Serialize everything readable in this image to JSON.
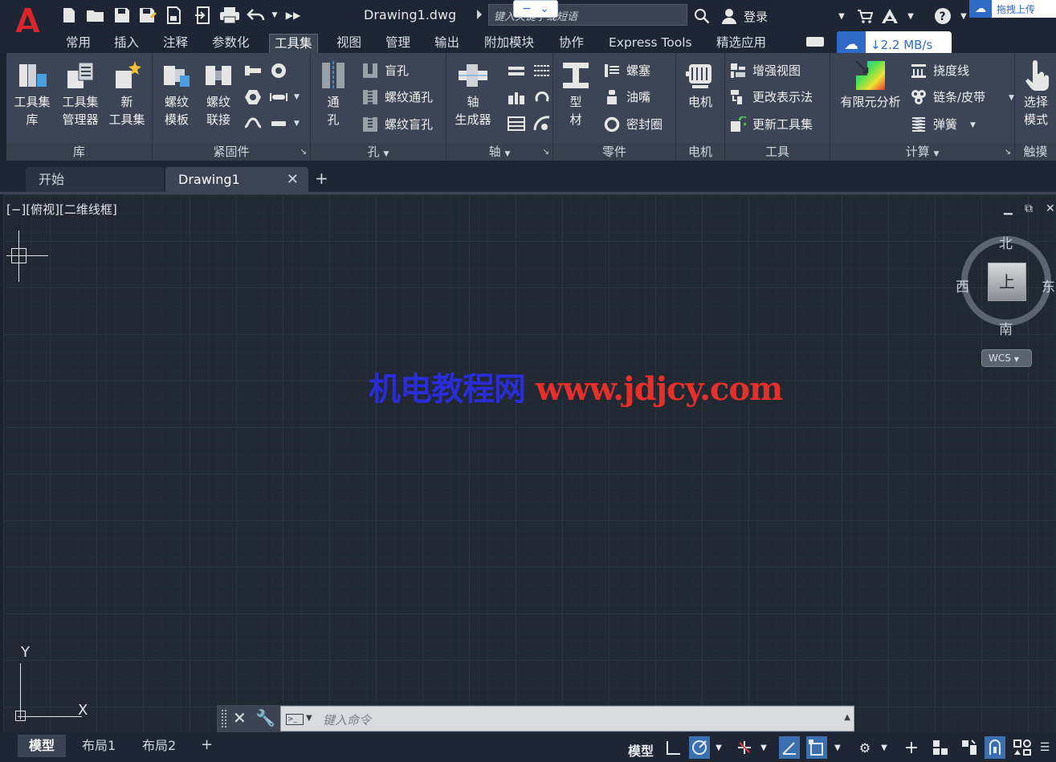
{
  "app": {
    "title": "Drawing1.dwg"
  },
  "titlebar": {
    "search_placeholder": "键入关键字或短语",
    "login_label": "登录",
    "cloud_upload_label": "拖拽上传"
  },
  "speed_widget": {
    "label": "↓2.2 MB/s"
  },
  "ribbon_tabs": [
    {
      "label": "常用"
    },
    {
      "label": "插入"
    },
    {
      "label": "注释"
    },
    {
      "label": "参数化"
    },
    {
      "label": "工具集"
    },
    {
      "label": "视图"
    },
    {
      "label": "管理"
    },
    {
      "label": "输出"
    },
    {
      "label": "附加模块"
    },
    {
      "label": "协作"
    },
    {
      "label": "Express Tools"
    },
    {
      "label": "精选应用"
    }
  ],
  "ribbon": {
    "lib": {
      "title": "库",
      "btn1": "工具集库",
      "btn1b": "库",
      "btn2": "工具集",
      "btn2b": "管理器",
      "btn3": "新",
      "btn3b": "工具集"
    },
    "fasteners": {
      "title": "紧固件",
      "btn1": "螺纹",
      "btn1b": "模板",
      "btn2": "螺纹",
      "btn2b": "联接"
    },
    "holes": {
      "title": "孔",
      "btn1": "通",
      "btn1b": "孔",
      "s1": "盲孔",
      "s2": "螺纹通孔",
      "s3": "螺纹盲孔"
    },
    "shaft": {
      "title": "轴",
      "btn1": "轴",
      "btn1b": "生成器"
    },
    "parts": {
      "title": "零件",
      "btn1": "型",
      "btn1b": "材",
      "s1": "螺塞",
      "s2": "油嘴",
      "s3": "密封圈"
    },
    "motor": {
      "title": "电机",
      "btn1": "电机"
    },
    "tools": {
      "title": "工具",
      "s1": "增强视图",
      "s2": "更改表示法",
      "s3": "更新工具集"
    },
    "calc": {
      "title": "计算",
      "btn1": "有限元分析",
      "s1": "挠度线",
      "s2": "链条/皮带",
      "s3": "弹簧"
    },
    "touch": {
      "title": "触摸",
      "btn1": "选择",
      "btn1b": "模式"
    }
  },
  "file_tabs": [
    {
      "label": "开始"
    },
    {
      "label": "Drawing1"
    }
  ],
  "viewport": {
    "label": "[−][俯视][二维线框]",
    "compass": {
      "north": "北",
      "south": "南",
      "east": "东",
      "west": "西",
      "top": "上"
    },
    "wcs": "WCS",
    "watermark_cn": "机电教程网",
    "watermark_url": "www.jdjcy.com",
    "ucs_x": "X",
    "ucs_y": "Y"
  },
  "command": {
    "placeholder": "键入命令"
  },
  "status": {
    "layout_tabs": [
      {
        "label": "模型"
      },
      {
        "label": "布局1"
      },
      {
        "label": "布局2"
      }
    ],
    "model_label": "模型"
  }
}
